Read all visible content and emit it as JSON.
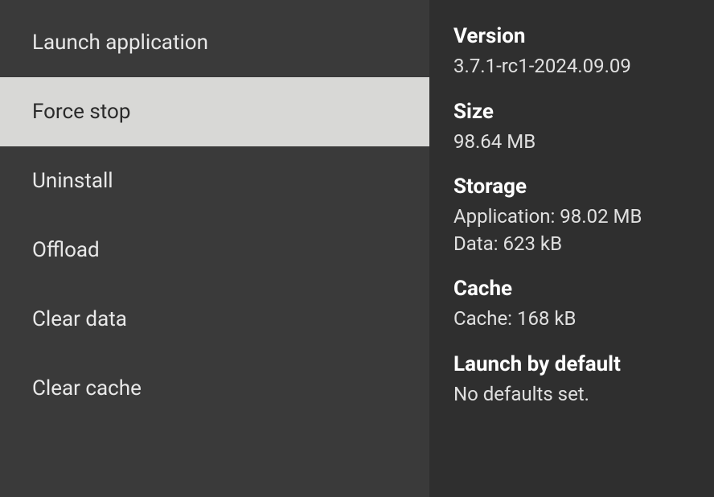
{
  "menu": {
    "items": [
      {
        "label": "Launch application",
        "selected": false
      },
      {
        "label": "Force stop",
        "selected": true
      },
      {
        "label": "Uninstall",
        "selected": false
      },
      {
        "label": "Offload",
        "selected": false
      },
      {
        "label": "Clear data",
        "selected": false
      },
      {
        "label": "Clear cache",
        "selected": false
      }
    ]
  },
  "details": {
    "version": {
      "heading": "Version",
      "value": "3.7.1-rc1-2024.09.09"
    },
    "size": {
      "heading": "Size",
      "value": "98.64 MB"
    },
    "storage": {
      "heading": "Storage",
      "application_label": "Application:",
      "application_value": "98.02 MB",
      "data_label": "Data:",
      "data_value": "623 kB"
    },
    "cache": {
      "heading": "Cache",
      "cache_label": "Cache:",
      "cache_value": "168 kB"
    },
    "launch_default": {
      "heading": "Launch by default",
      "value": "No defaults set."
    }
  }
}
